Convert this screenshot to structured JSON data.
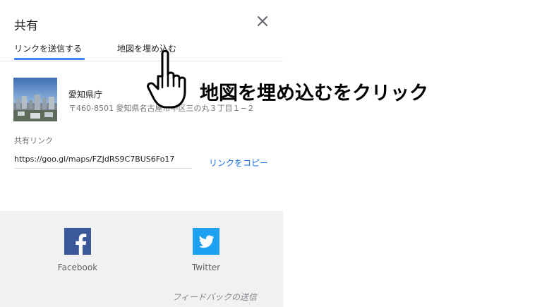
{
  "dialog": {
    "title": "共有",
    "tabs": [
      {
        "label": "リンクを送信する",
        "active": true
      },
      {
        "label": "地図を埋め込む",
        "active": false
      }
    ],
    "place": {
      "name": "愛知県庁",
      "address": "〒460-8501 愛知県名古屋市中区三の丸３丁目１−２"
    },
    "share_link_label": "共有リンク",
    "share_link_value": "https://goo.gl/maps/FZJdRS9C7BUS6Fo17",
    "copy_link_label": "リンクをコピー",
    "social": [
      {
        "label": "Facebook",
        "icon": "facebook-icon",
        "color": "#3b5998"
      },
      {
        "label": "Twitter",
        "icon": "twitter-icon",
        "color": "#1da1f2"
      }
    ],
    "feedback_label": "フィードバックの送信"
  },
  "annotation": {
    "text": "地図を埋め込むをクリック",
    "pointer_icon": "hand-pointer-icon"
  },
  "colors": {
    "accent": "#4285f4",
    "link": "#1a73e8",
    "social_panel": "#f1f1f1"
  }
}
